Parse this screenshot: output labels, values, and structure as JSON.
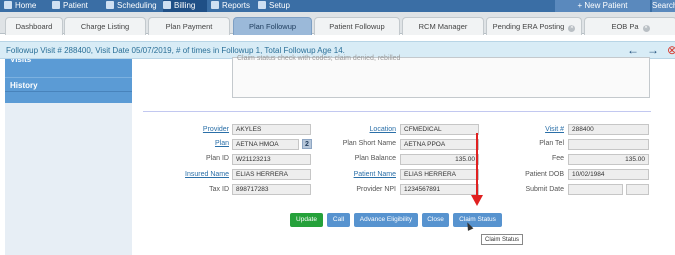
{
  "top_nav": {
    "items": [
      "Home",
      "Patient",
      "Scheduling",
      "Billing",
      "Reports",
      "Setup"
    ],
    "new_patient": "+ New Patient",
    "search": "Search"
  },
  "tabs": [
    {
      "label": "Dashboard",
      "active": false
    },
    {
      "label": "Charge Listing",
      "active": false
    },
    {
      "label": "Plan Payment",
      "active": false
    },
    {
      "label": "Plan Followup",
      "active": true
    },
    {
      "label": "Patient Followup",
      "active": false
    },
    {
      "label": "RCM Manager",
      "active": false
    },
    {
      "label": "Pending ERA Posting",
      "active": false
    },
    {
      "label": "EOB Pa",
      "active": false
    }
  ],
  "info_bar": {
    "text": "Followup Visit # 288400, Visit Date 05/07/2019, # of times in Followup 1, Total Followup Age 14.",
    "icons": [
      "arrow-left-icon",
      "arrow-right-icon",
      "close-icon"
    ]
  },
  "sidebar": {
    "visits_label": "Visits",
    "history_label": "History"
  },
  "notes": {
    "text": "Claim status check with codes; claim denied, rebilled"
  },
  "form": {
    "col1": [
      {
        "label": "Provider",
        "value": "AKYLES",
        "link": true
      },
      {
        "label": "Plan",
        "value": "AETNA HMOA",
        "link": true
      },
      {
        "label": "Plan ID",
        "value": "W21123213",
        "link": false
      },
      {
        "label": "Insured Name",
        "value": "ELIAS HERRERA",
        "link": true
      },
      {
        "label": "Tax ID",
        "value": "898717283",
        "link": false
      }
    ],
    "plan_badge": "2",
    "col2": [
      {
        "label": "Location",
        "value": "CFMEDICAL",
        "link": true
      },
      {
        "label": "Plan Short Name",
        "value": "AETNA PPOA",
        "link": false
      },
      {
        "label": "Plan Balance",
        "value": "135.00",
        "link": false
      },
      {
        "label": "Patient Name",
        "value": "ELIAS HERRERA",
        "link": true
      },
      {
        "label": "Provider NPI",
        "value": "1234567891",
        "link": false
      }
    ],
    "col3": [
      {
        "label": "Visit #",
        "value": "288400",
        "link": true
      },
      {
        "label": "Plan Tel",
        "value": "",
        "link": false
      },
      {
        "label": "Fee",
        "value": "135.00",
        "link": false
      },
      {
        "label": "Patient DOB",
        "value": "10/02/1984",
        "link": false
      },
      {
        "label": "Submit Date",
        "value": "",
        "link": false
      }
    ]
  },
  "buttons": {
    "update": "Update",
    "call": "Call",
    "advance_eligibility": "Advance Eligibility",
    "close": "Close",
    "claim_status": "Claim Status"
  },
  "tooltip": "Claim Status",
  "colors": {
    "nav_bg": "#3a6ea5",
    "accent_blue": "#5b9bd5",
    "update_green": "#25a13a",
    "annotation_red": "#e02020"
  }
}
